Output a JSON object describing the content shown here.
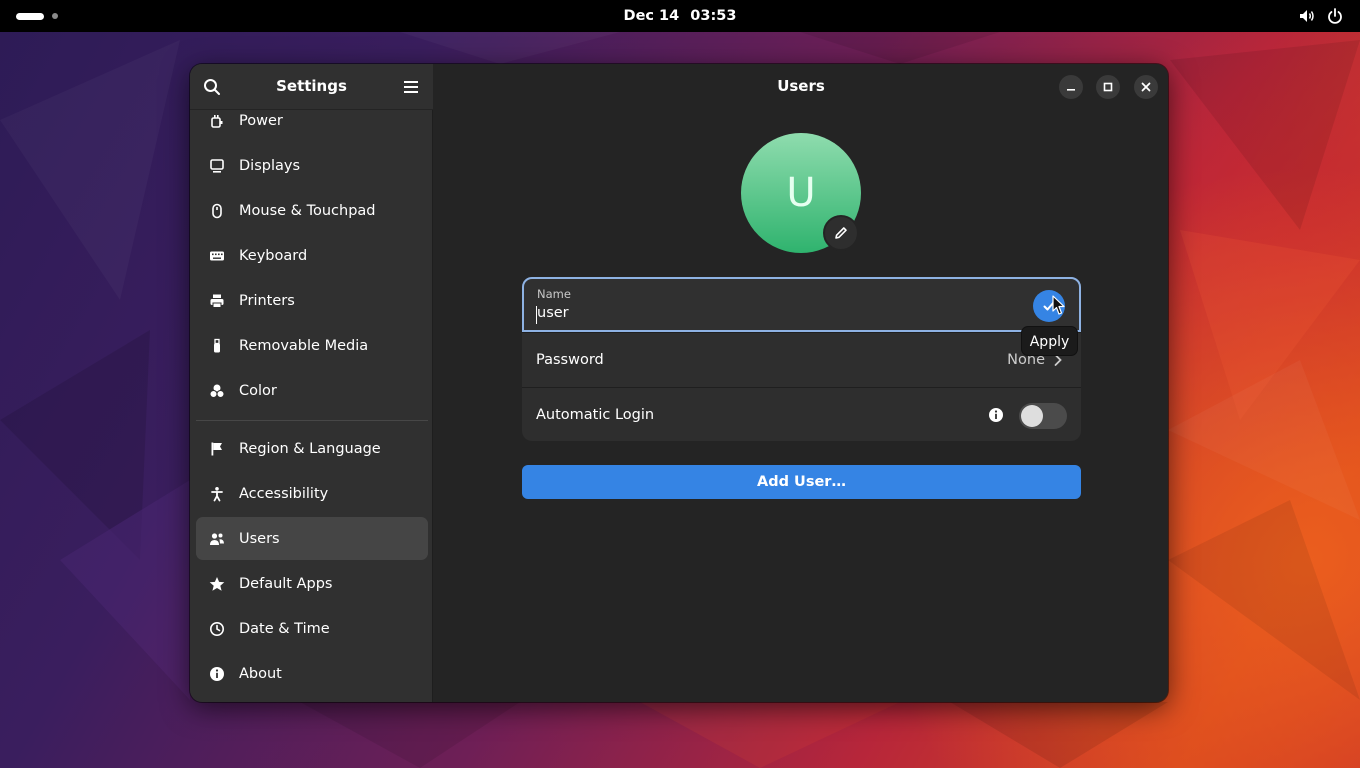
{
  "topbar": {
    "date": "Dec 14",
    "time": "03:53"
  },
  "sidebar": {
    "title": "Settings",
    "items": [
      {
        "label": "Power",
        "icon": "power-plug-icon"
      },
      {
        "label": "Displays",
        "icon": "display-icon"
      },
      {
        "label": "Mouse & Touchpad",
        "icon": "mouse-icon"
      },
      {
        "label": "Keyboard",
        "icon": "keyboard-icon"
      },
      {
        "label": "Printers",
        "icon": "printer-icon"
      },
      {
        "label": "Removable Media",
        "icon": "usb-icon"
      },
      {
        "label": "Color",
        "icon": "color-icon"
      },
      {
        "label": "Region & Language",
        "icon": "flag-icon"
      },
      {
        "label": "Accessibility",
        "icon": "accessibility-icon"
      },
      {
        "label": "Users",
        "icon": "users-icon",
        "selected": true
      },
      {
        "label": "Default Apps",
        "icon": "star-icon"
      },
      {
        "label": "Date & Time",
        "icon": "clock-icon"
      },
      {
        "label": "About",
        "icon": "info-icon"
      }
    ]
  },
  "main": {
    "title": "Users",
    "avatar_initial": "U",
    "name_label": "Name",
    "name_value": "user",
    "password_label": "Password",
    "password_value": "None",
    "auto_login_label": "Automatic Login",
    "auto_login_enabled": false,
    "add_user_label": "Add User…",
    "apply_tooltip": "Apply"
  },
  "colors": {
    "accent": "#3584e4",
    "avatar_top": "#8fdcae",
    "avatar_bottom": "#2fb36e",
    "sidebar_bg": "#303030",
    "content_bg": "#242424"
  }
}
